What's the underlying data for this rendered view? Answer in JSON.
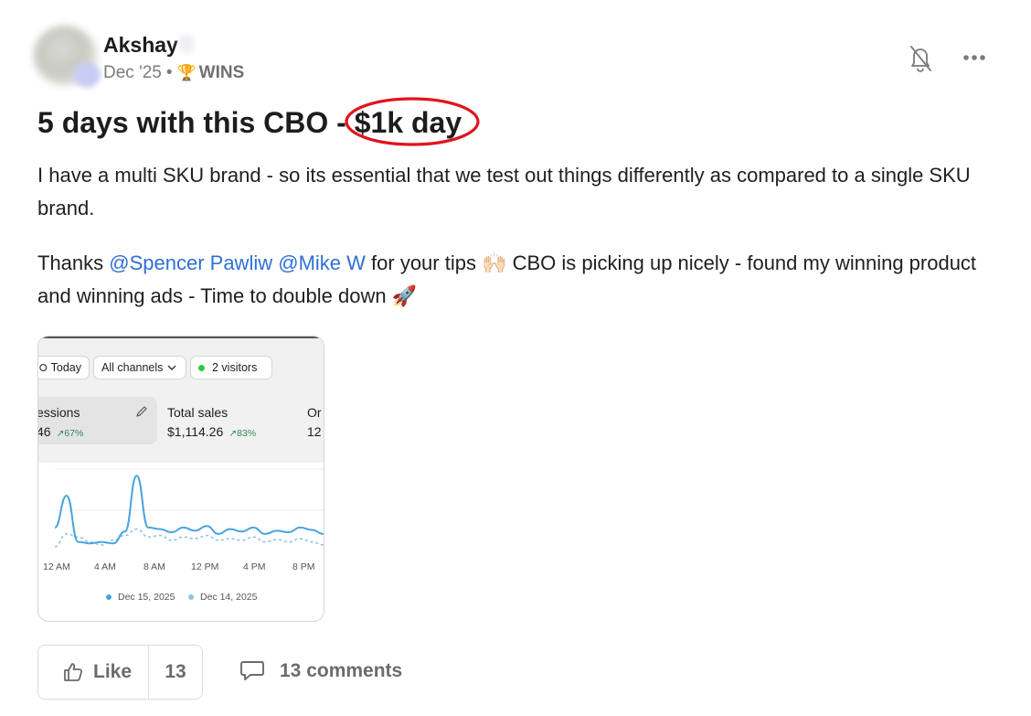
{
  "post": {
    "author": "Akshay",
    "date": "Dec '25",
    "separator": "•",
    "category_emoji": "🏆",
    "category": "WINS",
    "title_prefix": "5 days with this CBO - ",
    "title_highlight": "$1k day",
    "paragraph1": "I have a multi SKU brand - so its essential that we test out things differently as compared to a single SKU brand.",
    "p2_lead": "Thanks ",
    "mention1": "@Spencer Pawliw",
    "mention2": "@Mike W",
    "p2_rest": " for your tips 🙌🏻 CBO is picking up nicely - found my winning product and winning ads - Time to double down 🚀"
  },
  "screenshot": {
    "chip_today": "Today",
    "chip_channels": "All channels",
    "chip_visitors": "2 visitors",
    "sessions_label": "essions",
    "sessions_value": "46",
    "sessions_change": "↗67%",
    "sales_label": "Total sales",
    "sales_value": "$1,114.26",
    "sales_change": "↗83%",
    "orders_label": "Or",
    "orders_value": "12"
  },
  "chart_data": {
    "type": "line",
    "title": "",
    "xlabel": "",
    "ylabel": "",
    "x_ticks": [
      "12 AM",
      "4 AM",
      "8 AM",
      "12 PM",
      "4 PM",
      "8 PM"
    ],
    "x": [
      0,
      1,
      2,
      3,
      4,
      5,
      6,
      7,
      8,
      9,
      10,
      11,
      12,
      13,
      14,
      15,
      16,
      17,
      18,
      19,
      20,
      21,
      22,
      23
    ],
    "ylim": [
      0,
      100
    ],
    "grid": true,
    "legend_position": "bottom",
    "series": [
      {
        "name": "Dec 15, 2025",
        "color": "#4aa3df",
        "style": "solid",
        "values": [
          30,
          70,
          12,
          10,
          12,
          10,
          25,
          95,
          30,
          28,
          24,
          30,
          26,
          32,
          22,
          28,
          25,
          30,
          22,
          26,
          24,
          30,
          27,
          22
        ]
      },
      {
        "name": "Dec 14, 2025",
        "color": "#8cc3e6",
        "style": "dashed",
        "values": [
          6,
          22,
          18,
          12,
          8,
          14,
          20,
          28,
          18,
          20,
          14,
          18,
          16,
          20,
          14,
          16,
          14,
          18,
          12,
          15,
          12,
          16,
          12,
          8
        ]
      }
    ]
  },
  "actions": {
    "like_label": "Like",
    "like_count": "13",
    "comments_label": "13 comments"
  },
  "colors": {
    "mention": "#2f6fd6",
    "highlight_circle": "#e0141e",
    "positive_change": "#2e8b57"
  }
}
